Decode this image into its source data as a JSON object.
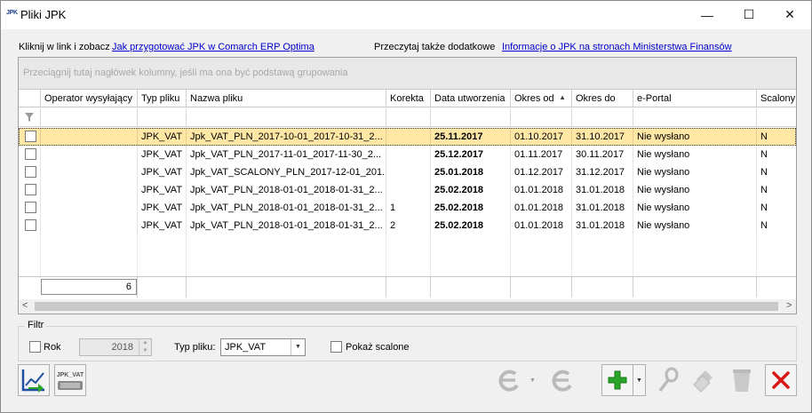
{
  "window": {
    "icon_text": "JPK",
    "title": "Pliki JPK",
    "minimize_glyph": "—",
    "maximize_glyph": "☐",
    "close_glyph": "✕"
  },
  "linkbar": {
    "prompt": "Kliknij w link i zobacz",
    "link1": "Jak przygotować JPK w Comarch ERP Optima",
    "prompt2": "Przeczytaj także dodatkowe",
    "link2": "Informacje o JPK na stronach Ministerstwa Finansów"
  },
  "grid": {
    "group_hint": "Przeciągnij tutaj nagłówek kolumny, jeśli ma ona być podstawą grupowania",
    "columns": [
      "",
      "Operator wysyłający",
      "Typ pliku",
      "Nazwa pliku",
      "Korekta",
      "Data utworzenia",
      "Okres od",
      "Okres do",
      "e-Portal",
      "Scalony"
    ],
    "sort_indicator": "▲",
    "rows": [
      {
        "operator": "",
        "typ": "JPK_VAT",
        "nazwa": "Jpk_VAT_PLN_2017-10-01_2017-10-31_2...",
        "korekta": "",
        "data": "25.11.2017",
        "od": "01.10.2017",
        "do": "31.10.2017",
        "eportal": "Nie wysłano",
        "scalony": "N"
      },
      {
        "operator": "",
        "typ": "JPK_VAT",
        "nazwa": "Jpk_VAT_PLN_2017-11-01_2017-11-30_2...",
        "korekta": "",
        "data": "25.12.2017",
        "od": "01.11.2017",
        "do": "30.11.2017",
        "eportal": "Nie wysłano",
        "scalony": "N"
      },
      {
        "operator": "",
        "typ": "JPK_VAT",
        "nazwa": "Jpk_VAT_SCALONY_PLN_2017-12-01_201...",
        "korekta": "",
        "data": "25.01.2018",
        "od": "01.12.2017",
        "do": "31.12.2017",
        "eportal": "Nie wysłano",
        "scalony": "N"
      },
      {
        "operator": "",
        "typ": "JPK_VAT",
        "nazwa": "Jpk_VAT_PLN_2018-01-01_2018-01-31_2...",
        "korekta": "",
        "data": "25.02.2018",
        "od": "01.01.2018",
        "do": "31.01.2018",
        "eportal": "Nie wysłano",
        "scalony": "N"
      },
      {
        "operator": "",
        "typ": "JPK_VAT",
        "nazwa": "Jpk_VAT_PLN_2018-01-01_2018-01-31_2...",
        "korekta": "1",
        "data": "25.02.2018",
        "od": "01.01.2018",
        "do": "31.01.2018",
        "eportal": "Nie wysłano",
        "scalony": "N"
      },
      {
        "operator": "",
        "typ": "JPK_VAT",
        "nazwa": "Jpk_VAT_PLN_2018-01-01_2018-01-31_2...",
        "korekta": "2",
        "data": "25.02.2018",
        "od": "01.01.2018",
        "do": "31.01.2018",
        "eportal": "Nie wysłano",
        "scalony": "N"
      }
    ],
    "selected_row": 0,
    "count": "6",
    "scroll_left": "<",
    "scroll_right": ">"
  },
  "filter": {
    "legend": "Filtr",
    "rok_label": "Rok",
    "rok_value": "2018",
    "typ_label": "Typ pliku:",
    "typ_value": "JPK_VAT",
    "scalone_label": "Pokaż scalone"
  },
  "toolbar": {
    "jpk_vat_icon_text": "JPK_VAT"
  },
  "colors": {
    "selection": "#ffe8a6",
    "link": "#0000cc",
    "add_green": "#2aa52a",
    "delete_red": "#d81818"
  }
}
